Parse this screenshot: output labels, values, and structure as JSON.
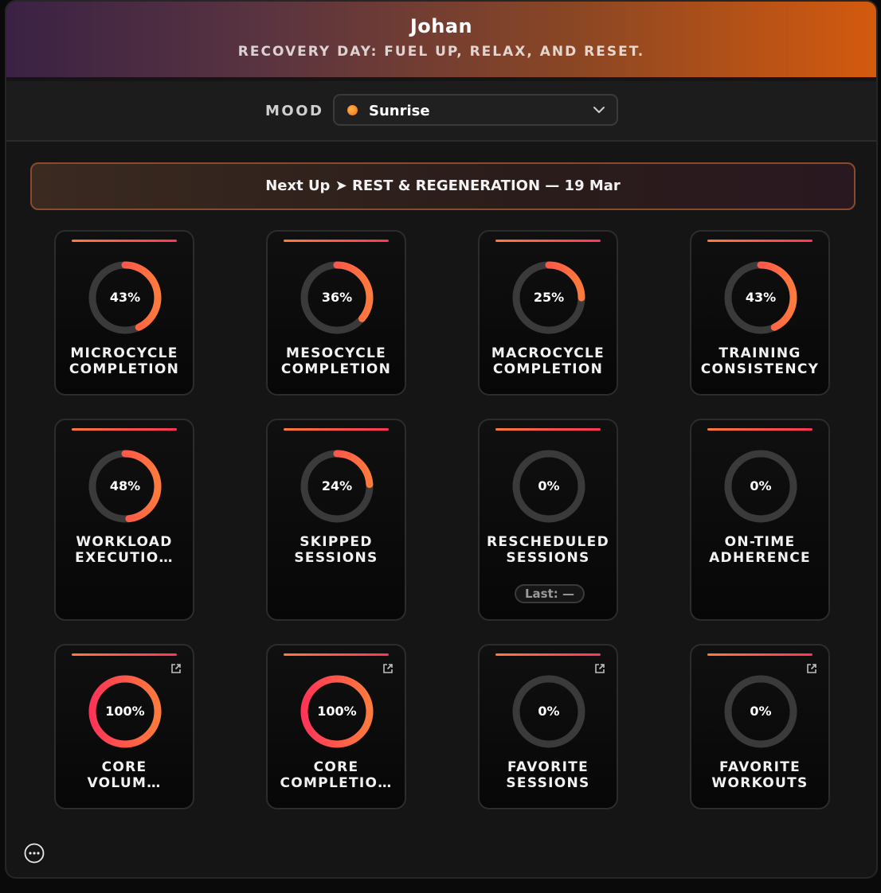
{
  "header": {
    "name": "Johan",
    "tagline": "RECOVERY DAY: FUEL UP, RELAX, AND RESET."
  },
  "mood": {
    "label": "MOOD",
    "selected": "Sunrise"
  },
  "next_up": {
    "text": "Next Up ➤ REST & REGENERATION — 19 Mar"
  },
  "cards": [
    {
      "percent_text": "43%",
      "percent": 43,
      "line1": "MICROCYCLE",
      "line2": "COMPLETION"
    },
    {
      "percent_text": "36%",
      "percent": 36,
      "line1": "MESOCYCLE",
      "line2": "COMPLETION"
    },
    {
      "percent_text": "25%",
      "percent": 25,
      "line1": "MACROCYCLE",
      "line2": "COMPLETION"
    },
    {
      "percent_text": "43%",
      "percent": 43,
      "line1": "TRAINING",
      "line2": "CONSISTENCY"
    },
    {
      "percent_text": "48%",
      "percent": 48,
      "line1": "WORKLOAD",
      "line2": "EXECUTIO…"
    },
    {
      "percent_text": "24%",
      "percent": 24,
      "line1": "SKIPPED",
      "line2": "SESSIONS"
    },
    {
      "percent_text": "0%",
      "percent": 0,
      "line1": "RESCHEDULED",
      "line2": "SESSIONS",
      "last": "Last: —"
    },
    {
      "percent_text": "0%",
      "percent": 0,
      "line1": "ON-TIME",
      "line2": "ADHERENCE"
    },
    {
      "percent_text": "100%",
      "percent": 100,
      "line1": "CORE",
      "line2": "VOLUM…",
      "link": true
    },
    {
      "percent_text": "100%",
      "percent": 100,
      "line1": "CORE",
      "line2": "COMPLETIO…",
      "link": true
    },
    {
      "percent_text": "0%",
      "percent": 0,
      "line1": "FAVORITE",
      "line2": "SESSIONS",
      "link": true
    },
    {
      "percent_text": "0%",
      "percent": 0,
      "line1": "FAVORITE",
      "line2": "WORKOUTS",
      "link": true
    }
  ],
  "icons": {
    "mood_chevron": "chevron-down-icon",
    "external_link": "external-link-icon",
    "more": "more-options-icon"
  },
  "colors": {
    "ring_track": "#3a3a3a",
    "ring_start": "#ff3558",
    "ring_end": "#ff7a3c",
    "mood_dot": "#f06a1e"
  }
}
